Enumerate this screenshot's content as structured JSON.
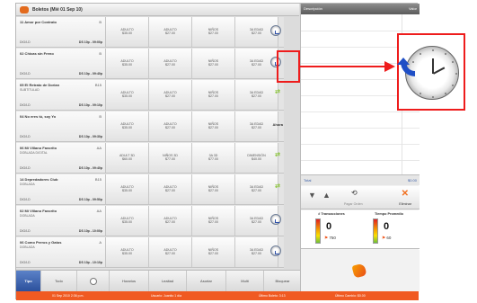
{
  "window": {
    "title": "Boletos (Mié 01 Sep 10)"
  },
  "movies": [
    {
      "title": "11 Amor por Contrato",
      "rating": "B",
      "sub": "",
      "room": "DIG/LD",
      "times": "DS 10p - 09:00p"
    },
    {
      "title": "02 Chicas sin Freno",
      "rating": "B",
      "sub": "",
      "room": "DIG/LD",
      "times": "DS 10p - 09:40p"
    },
    {
      "title": "05 El Retrato de Dorian",
      "rating": "B15",
      "sub": "SUBTITULAD",
      "room": "DIG/LD",
      "times": "DS 10p - 09:10p"
    },
    {
      "title": "04 No eres tú, soy Yo",
      "rating": "B",
      "sub": "",
      "room": "DIG/LD",
      "times": "DS 10p - 09:30p"
    },
    {
      "title": "06 Mi Villano Favorito",
      "rating": "AA",
      "sub": "DOBLADA DIGITAL",
      "room": "DIG/LD",
      "times": "DS 10p - 09:40p"
    },
    {
      "title": "14 Depredadores Club",
      "rating": "B15",
      "sub": "DOBLADA",
      "room": "DIG/LD",
      "times": "DS 10p - 09:50p"
    },
    {
      "title": "02 Mi Villano Favorito",
      "rating": "AA",
      "sub": "DOBLADA",
      "room": "DIG/LD",
      "times": "DS 10p - 10:00p"
    },
    {
      "title": "06 Como Perros y Gatos",
      "rating": "A",
      "sub": "DOBLADA",
      "room": "DIG/LD",
      "times": "DS 10p - 10:10p"
    }
  ],
  "prices": [
    [
      {
        "label": "ADULTO",
        "price": "$35.00"
      },
      {
        "label": "ADULTO",
        "price": "$27.00"
      },
      {
        "label": "NIÑOS",
        "price": "$27.00"
      },
      {
        "label": "3A EDAD",
        "price": "$27.00"
      }
    ],
    [
      {
        "label": "ADULTO",
        "price": "$35.00"
      },
      {
        "label": "ADULTO",
        "price": "$27.00"
      },
      {
        "label": "NIÑOS",
        "price": "$27.00"
      },
      {
        "label": "3A EDAD",
        "price": "$27.00"
      }
    ],
    [
      {
        "label": "ADULTO",
        "price": "$35.00"
      },
      {
        "label": "ADULTO",
        "price": "$27.00"
      },
      {
        "label": "NIÑOS",
        "price": "$27.00"
      },
      {
        "label": "3A EDAD",
        "price": "$27.00"
      }
    ],
    [
      {
        "label": "ADULTO",
        "price": "$35.00"
      },
      {
        "label": "ADULTO",
        "price": "$27.00"
      },
      {
        "label": "NIÑOS",
        "price": "$27.00"
      },
      {
        "label": "3A EDAD",
        "price": "$27.00"
      }
    ],
    [
      {
        "label": "ADULT 3D",
        "price": "$60.00"
      },
      {
        "label": "NIÑOS 3D",
        "price": "$77.00"
      },
      {
        "label": "3A 3D",
        "price": "$77.00"
      },
      {
        "label": "DIMENSIÓN",
        "price": "$40.00"
      }
    ],
    [
      {
        "label": "ADULTO",
        "price": "$35.00"
      },
      {
        "label": "ADULTO",
        "price": "$27.00"
      },
      {
        "label": "NIÑOS",
        "price": "$27.00"
      },
      {
        "label": "3A EDAD",
        "price": "$27.00"
      }
    ],
    [
      {
        "label": "ADULTO",
        "price": "$35.00"
      },
      {
        "label": "ADULTO",
        "price": "$27.00"
      },
      {
        "label": "NIÑOS",
        "price": "$27.00"
      },
      {
        "label": "3A EDAD",
        "price": "$27.00"
      }
    ],
    [
      {
        "label": "ADULTO",
        "price": "$35.00"
      },
      {
        "label": "ADULTO",
        "price": "$27.00"
      },
      {
        "label": "NIÑOS",
        "price": "$27.00"
      },
      {
        "label": "3A EDAD",
        "price": "$27.00"
      }
    ]
  ],
  "row_buttons": [
    "clock-icon",
    "clock-icon",
    "green-arrows-icon",
    "Ahora",
    "green-arrows-icon",
    "green-arrows-icon",
    "clock-icon",
    "clock-icon"
  ],
  "ahora_label": "Ahora",
  "tabs": [
    "Tipo",
    "Todo",
    "",
    "Horarios",
    "Lealtad",
    "Asortar",
    "Multi",
    "Bloquear"
  ],
  "status": {
    "left": "01 Sep 2010 2:36 p.m.",
    "center": "Usuario: Juanito 1 día",
    "right1": "Último Boleto: 3:13",
    "right2": "Último Cambio: $0.00"
  },
  "cart": {
    "description_header": "Descripción",
    "value_header": "Valor",
    "total_label": "Total",
    "total_value": "$0.00"
  },
  "actions": {
    "pay_label": "Pagar Orden",
    "cancel_label": "Eliminar"
  },
  "stats": {
    "transactions": {
      "title": "# Transacciones",
      "value": "0",
      "sub": "750",
      "level": 0
    },
    "avg_time": {
      "title": "Tiempo Promedio",
      "value": "0",
      "sub": "60",
      "level": 0
    }
  },
  "colors": {
    "accent_orange": "#F05A22",
    "highlight_red": "#EE1C1C",
    "tab_blue": "#2A4E9A"
  }
}
